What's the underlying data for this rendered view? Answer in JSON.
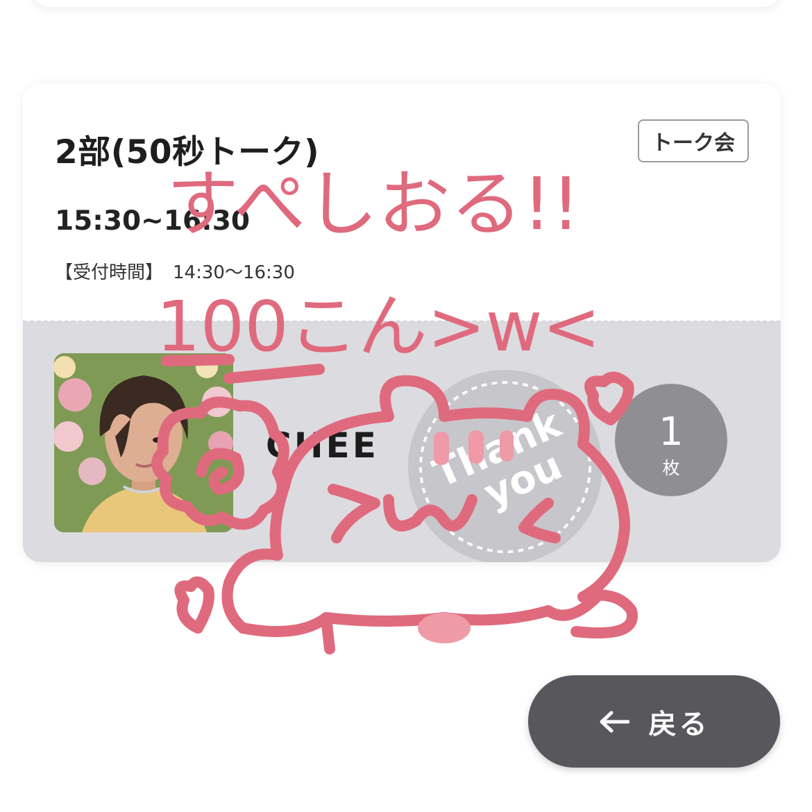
{
  "ticket": {
    "title": "2部(50秒トーク)",
    "badge": "トーク会",
    "time": "15:30~16:30",
    "reception_label": "【受付時間】",
    "reception_time": "14:30〜16:30",
    "artist_name": "CHEE",
    "count": "1",
    "count_unit": "枚"
  },
  "stamp": {
    "text_line1": "Thank",
    "text_line2": "you"
  },
  "back_button": {
    "label": "戻る",
    "icon": "arrow-left-icon"
  },
  "doodle": {
    "line1": "すぺしおる!!",
    "line2": "100こん>w<",
    "face_text": ">w<"
  },
  "colors": {
    "doodle": "#e06a7d",
    "count_badge": "#8f8e92",
    "back_button": "#58575c",
    "card_body": "#dcdbe0"
  }
}
